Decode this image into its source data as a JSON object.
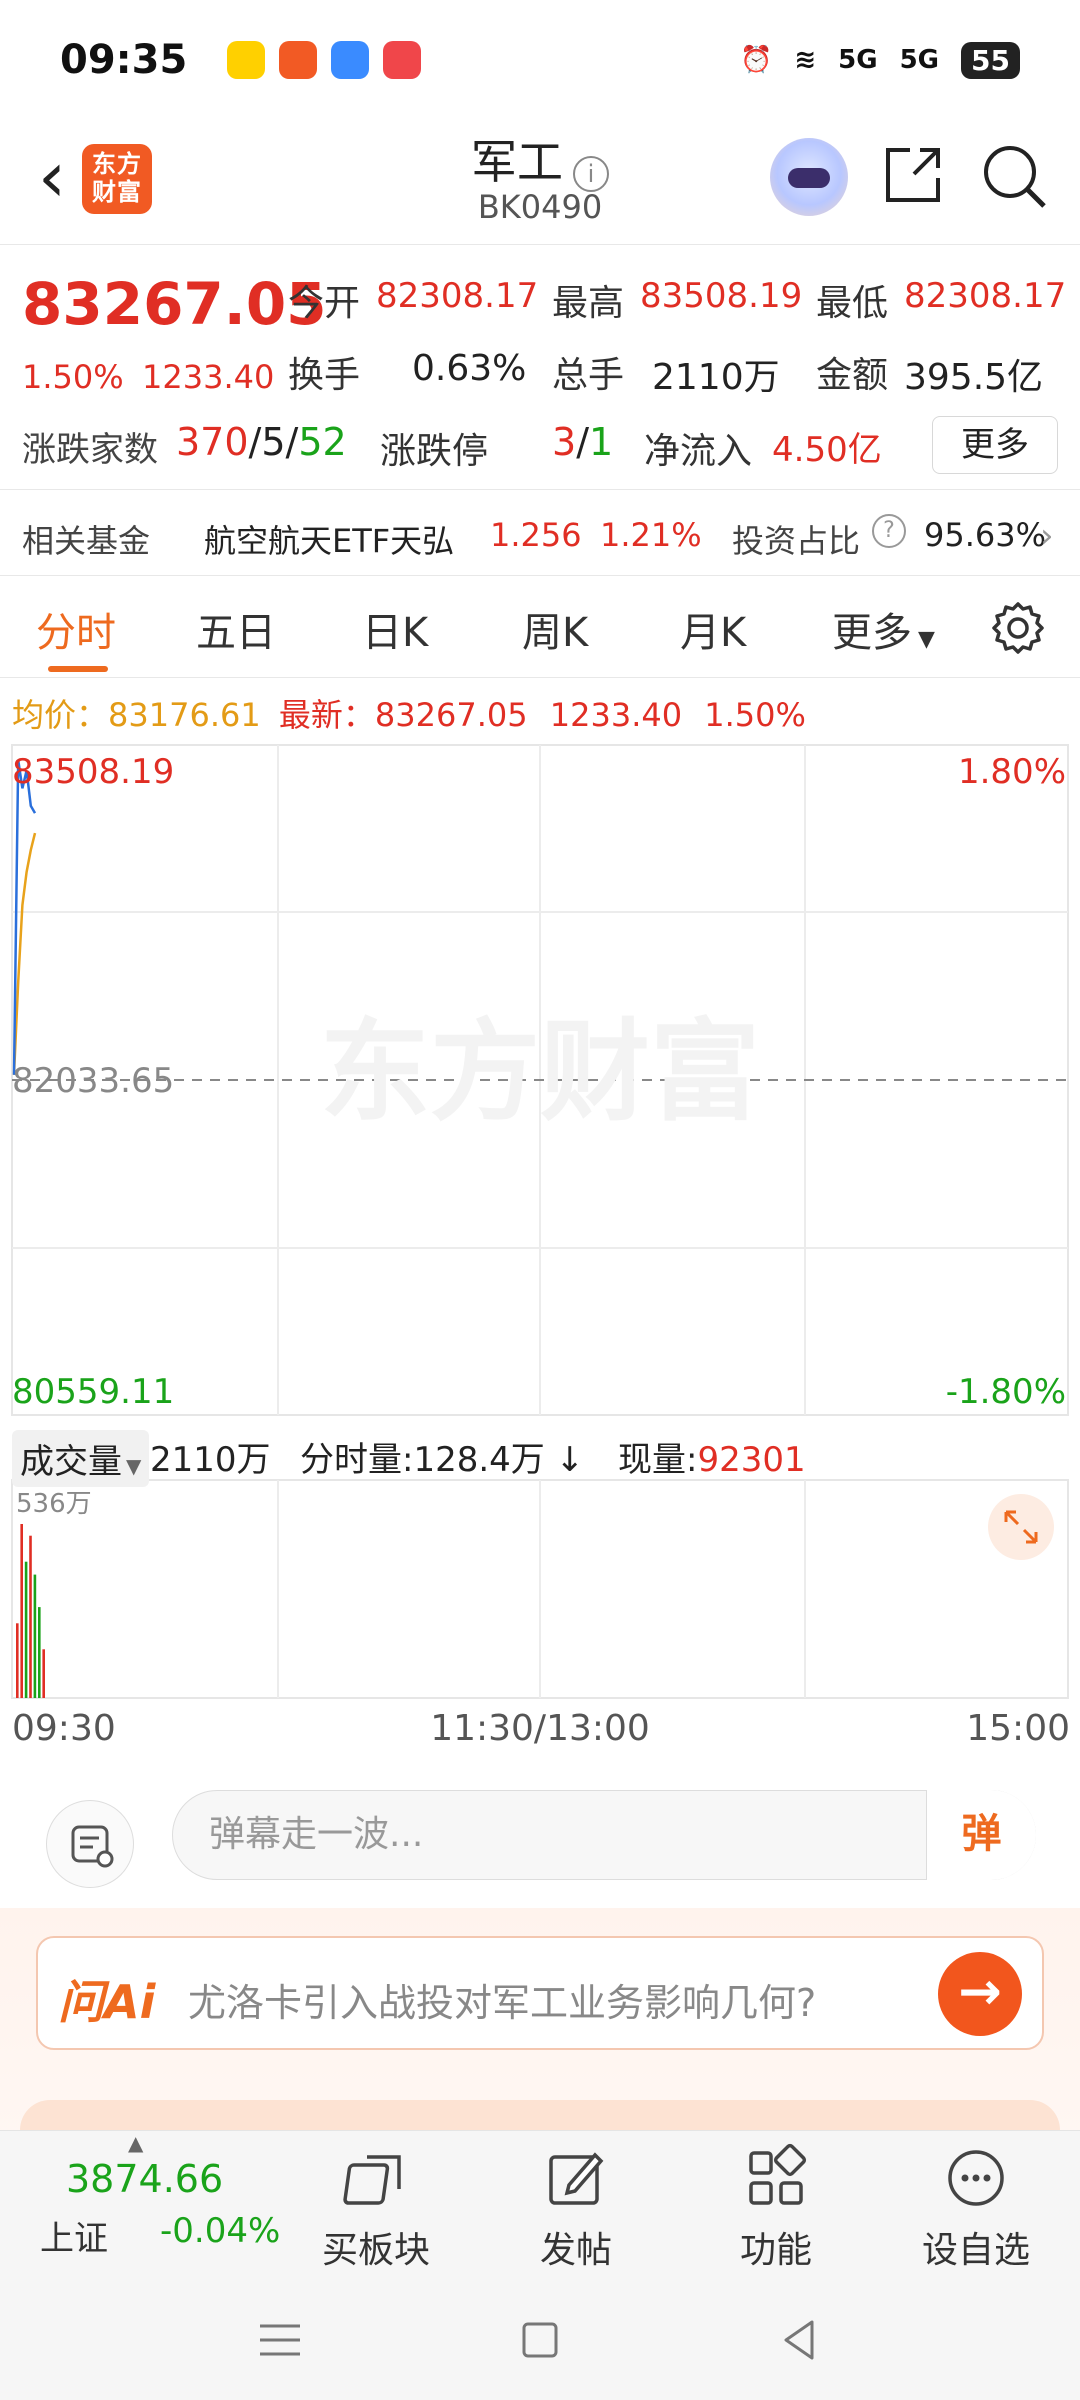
{
  "status_bar": {
    "time": "09:35",
    "network": "5G",
    "battery": "55",
    "app_icons": [
      "meituan-icon",
      "app-grid-icon",
      "bird-icon",
      "video-icon"
    ]
  },
  "header": {
    "back_icon": "back-arrow-icon",
    "logo_text": "东方财富",
    "title": "军工",
    "code": "BK0490",
    "icons": [
      "robot-icon",
      "share-icon",
      "search-icon"
    ]
  },
  "quote": {
    "price": "83267.05",
    "change_pct": "1.50%",
    "change": "1233.40",
    "open_label": "今开",
    "open": "82308.17",
    "high_label": "最高",
    "high": "83508.19",
    "low_label": "最低",
    "low": "82308.17",
    "turnover_label": "换手",
    "turnover": "0.63%",
    "volume_label": "总手",
    "volume": "2110万",
    "amount_label": "金额",
    "amount": "395.5亿",
    "updown_label": "涨跌家数",
    "up_count": "370",
    "flat_count": "5",
    "down_count": "52",
    "limit_label": "涨跌停",
    "limit_up": "3",
    "limit_down": "1",
    "netflow_label": "净流入",
    "netflow": "4.50亿",
    "more_label": "更多"
  },
  "fund": {
    "label": "相关基金",
    "name": "航空航天ETF天弘",
    "price": "1.256",
    "pct": "1.21%",
    "ratio_label": "投资占比",
    "ratio": "95.63%"
  },
  "tabs": [
    {
      "label": "分时",
      "active": true
    },
    {
      "label": "五日"
    },
    {
      "label": "日K"
    },
    {
      "label": "周K"
    },
    {
      "label": "月K"
    },
    {
      "label": "更多"
    }
  ],
  "avg_row": {
    "avg_label": "均价：",
    "avg": "83176.61",
    "latest_label": "最新：",
    "latest": "83267.05",
    "change": "1233.40",
    "pct": "1.50%"
  },
  "chart": {
    "watermark": "东方财富",
    "top_price": "83508.19",
    "top_pct": "1.80%",
    "mid_price": "82033.65",
    "bottom_price": "80559.11",
    "bottom_pct": "-1.80%",
    "volume_max_label": "536万",
    "time_labels": [
      "09:30",
      "11:30/13:00",
      "15:00"
    ]
  },
  "chart_data": {
    "type": "line",
    "ylim": [
      80559.11,
      83508.19
    ],
    "reference": 82033.65,
    "series": [
      {
        "values": [
          82080,
          83508.19,
          83380,
          83460,
          83300,
          83267.05
        ]
      },
      {
        "values": [
          82080,
          82500,
          82850,
          83000,
          83100,
          83176.61
        ]
      }
    ],
    "volume": {
      "ylim": [
        0,
        5360000
      ],
      "values": [
        2300000,
        5360000,
        4200000,
        5000000,
        3800000,
        2800000,
        1500000
      ],
      "colors": [
        "red",
        "red",
        "green",
        "red",
        "green",
        "green",
        "red"
      ]
    }
  },
  "volume_row": {
    "select_label": "成交量",
    "total": "2110万",
    "tick_label": "分时量:",
    "tick": "128.4万",
    "now_label": "现量:",
    "now": "92301"
  },
  "comment": {
    "placeholder": "弹幕走一波...",
    "danmu_label": "弹"
  },
  "ai": {
    "logo": "问Ai",
    "question": "尤洛卡引入战投对军工业务影响几何?"
  },
  "bottom_tabs": {
    "index_value": "3874.66",
    "index_name": "上证",
    "index_change": "-0.04%",
    "items": [
      "买板块",
      "发帖",
      "功能",
      "设自选"
    ]
  }
}
